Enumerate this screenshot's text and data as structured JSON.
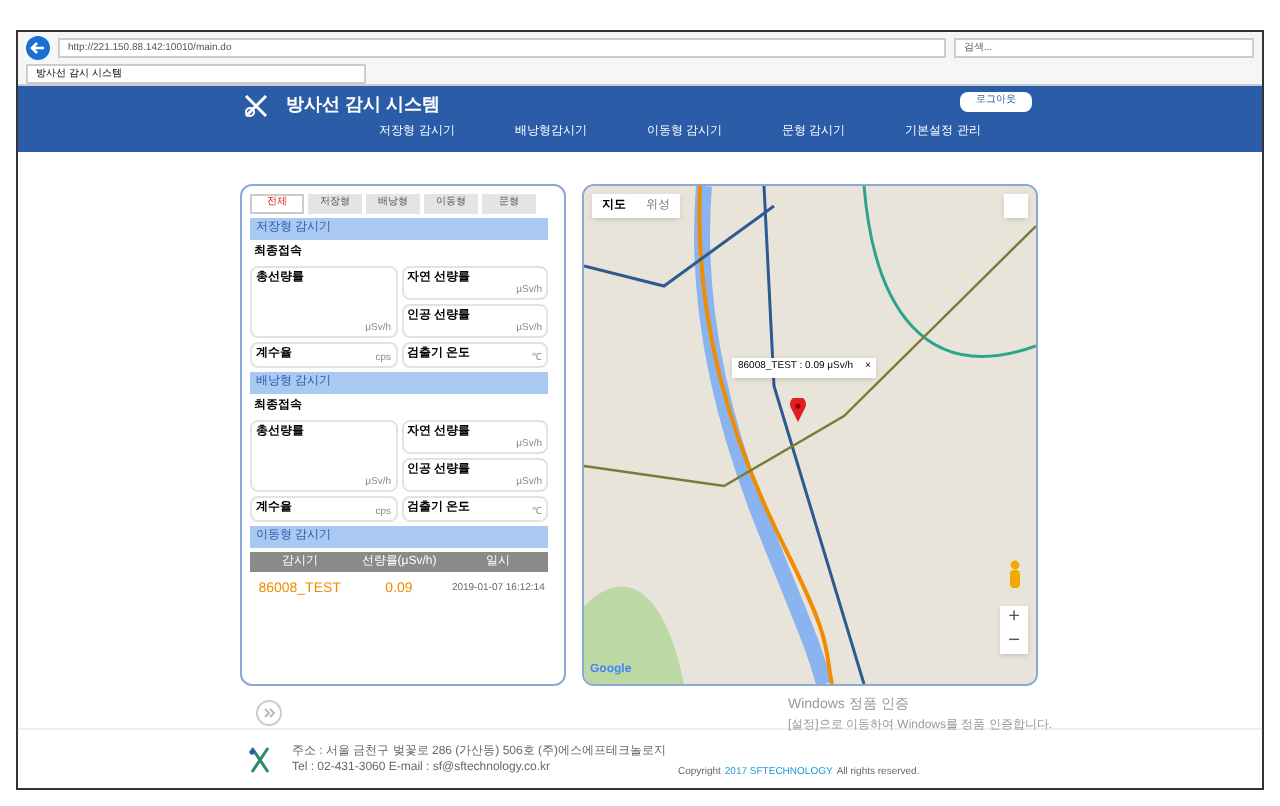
{
  "browser": {
    "url": "http://221.150.88.142:10010/main.do",
    "search_placeholder": "검색...",
    "tab_title": "방사선 감시 시스템"
  },
  "header": {
    "title": "방사선 감시 시스템",
    "logout": "로그아웃",
    "nav": [
      "저장형 감시기",
      "배낭형감시기",
      "이동형 감시기",
      "문형 감시기",
      "기본설정 관리"
    ]
  },
  "panel": {
    "tabs": [
      {
        "label": "전체",
        "selected": true
      },
      {
        "label": "저장형",
        "selected": false
      },
      {
        "label": "배낭형",
        "selected": false
      },
      {
        "label": "이동형",
        "selected": false
      },
      {
        "label": "문형",
        "selected": false
      }
    ],
    "sections": [
      {
        "title": "저장형 감시기",
        "last_connect": "최종접속",
        "total": {
          "label": "총선량률",
          "unit": "μSv/h"
        },
        "fields": [
          {
            "label": "자연 선량률",
            "unit": "μSv/h"
          },
          {
            "label": "인공 선량률",
            "unit": "μSv/h"
          }
        ],
        "count": {
          "label": "계수율",
          "unit": "cps"
        },
        "temp": {
          "label": "검출기 온도",
          "unit": "℃"
        }
      },
      {
        "title": "배낭형 감시기",
        "last_connect": "최종접속",
        "total": {
          "label": "총선량률",
          "unit": "μSv/h"
        },
        "fields": [
          {
            "label": "자연 선량률",
            "unit": "μSv/h"
          },
          {
            "label": "인공 선량률",
            "unit": "μSv/h"
          }
        ],
        "count": {
          "label": "계수율",
          "unit": "cps"
        },
        "temp": {
          "label": "검출기 온도",
          "unit": "℃"
        }
      }
    ],
    "mobile": {
      "title": "이동형 감시기",
      "columns": [
        "감시기",
        "선량률(μSv/h)",
        "일시"
      ],
      "rows": [
        [
          "86008_TEST",
          "0.09",
          "2019-01-07 16:12:14"
        ]
      ]
    }
  },
  "map": {
    "tabs": [
      {
        "label": "지도",
        "selected": true
      },
      {
        "label": "위성",
        "selected": false
      }
    ],
    "popup": "86008_TEST : 0.09 μSv/h",
    "popup_close": "×",
    "zoom_in": "+",
    "zoom_out": "−",
    "logo": "Google"
  },
  "footer": {
    "address": "주소 : 서울 금천구 벚꽃로 286 (가산동) 506호 (주)에스에프테크놀로지",
    "contact": "Tel : 02-431-3060 E-mail : sf@sftechnology.co.kr",
    "copyright_prefix": "Copyright",
    "copyright_link": "2017 SFTECHNOLOGY",
    "copyright_suffix": "All rights reserved."
  },
  "windows_notice": {
    "title": "Windows 정품 인증",
    "text": "[설정]으로 이동하여 Windows를 정품 인증합니다."
  }
}
